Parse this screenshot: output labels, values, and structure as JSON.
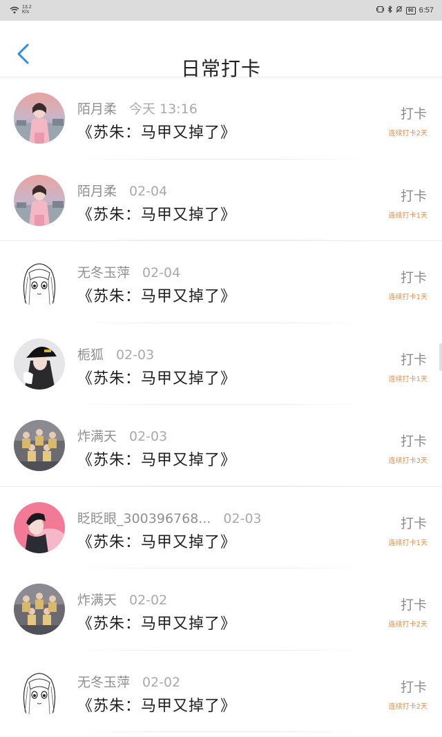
{
  "status_bar": {
    "net_speed_value": "13.2",
    "net_speed_unit": "K/s",
    "battery": "90",
    "time": "6:57"
  },
  "header": {
    "title": "日常打卡",
    "back_icon": "chevron-left-icon"
  },
  "colors": {
    "accent_blue": "#2a8ee6",
    "streak_orange": "#f08a3c",
    "status_bar_bg": "#dcdcdc"
  },
  "items": [
    {
      "user": "陌月柔",
      "time": "今天 13:16",
      "book": "《苏朱：马甲又掉了》",
      "action": "打卡",
      "streak": "连续打卡2天",
      "avatar": "avatar-girl-sunset"
    },
    {
      "user": "陌月柔",
      "time": "02-04",
      "book": "《苏朱：马甲又掉了》",
      "action": "打卡",
      "streak": "连续打卡1天",
      "avatar": "avatar-girl-sunset"
    },
    {
      "user": "无冬玉萍",
      "time": "02-04",
      "book": "《苏朱：马甲又掉了》",
      "action": "打卡",
      "streak": "连续打卡1天",
      "avatar": "avatar-anime-sketch"
    },
    {
      "user": "栀狐",
      "time": "02-03",
      "book": "《苏朱：马甲又掉了》",
      "action": "打卡",
      "streak": "连续打卡1天",
      "avatar": "avatar-girl-hat"
    },
    {
      "user": "炸满天",
      "time": "02-03",
      "book": "《苏朱：马甲又掉了》",
      "action": "打卡",
      "streak": "连续打卡3天",
      "avatar": "avatar-group"
    },
    {
      "user": "眨眨眼_300396768...",
      "time": "02-03",
      "book": "《苏朱：马甲又掉了》",
      "action": "打卡",
      "streak": "连续打卡1天",
      "avatar": "avatar-pink"
    },
    {
      "user": "炸满天",
      "time": "02-02",
      "book": "《苏朱：马甲又掉了》",
      "action": "打卡",
      "streak": "连续打卡2天",
      "avatar": "avatar-group"
    },
    {
      "user": "无冬玉萍",
      "time": "02-02",
      "book": "《苏朱：马甲又掉了》",
      "action": "打卡",
      "streak": "连续打卡2天",
      "avatar": "avatar-anime-sketch"
    }
  ]
}
